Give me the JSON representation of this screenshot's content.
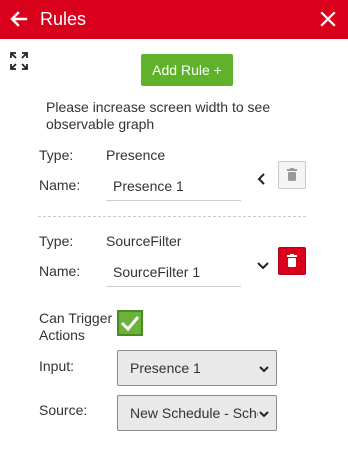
{
  "header": {
    "title": "Rules",
    "back_icon": "arrow-left-icon",
    "close_icon": "close-icon",
    "background": "#d9001b"
  },
  "toolbar": {
    "expand_icon": "expand-icon",
    "add_rule_label": "Add Rule +",
    "add_rule_color": "#5fb32a"
  },
  "notice": "Please increase screen width to see observable graph",
  "rules": [
    {
      "type_label": "Type:",
      "type_value": "Presence",
      "name_label": "Name:",
      "name_value": "Presence 1",
      "expanded": false,
      "delete_enabled": false
    },
    {
      "type_label": "Type:",
      "type_value": "SourceFilter",
      "name_label": "Name:",
      "name_value": "SourceFilter 1",
      "expanded": true,
      "delete_enabled": true
    }
  ],
  "details": {
    "can_trigger_label_line1": "Can Trigger",
    "can_trigger_label_line2": "Actions",
    "can_trigger_checked": true,
    "input_label": "Input:",
    "input_value": "Presence 1",
    "source_label": "Source:",
    "source_value": "New Schedule - Schedule"
  }
}
